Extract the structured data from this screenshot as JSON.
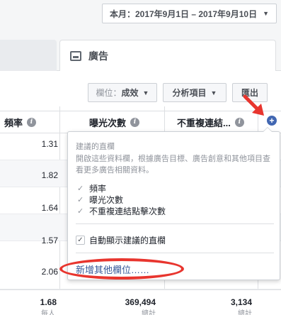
{
  "header": {
    "date_range": "本月：2017年9月1日 – 2017年9月10日"
  },
  "tabs": {
    "ads_label": "廣告"
  },
  "toolbar": {
    "columns_prefix": "欄位：",
    "columns_value": "成效",
    "breakdown_label": "分析項目",
    "export_label": "匯出"
  },
  "table": {
    "headers": {
      "frequency": "頻率",
      "impressions": "曝光次數",
      "unique_link_clicks": "不重複連結..."
    },
    "frequency_values": [
      "1.31",
      "1.82",
      "1.64",
      "1.57",
      "2.06"
    ],
    "totals": {
      "frequency": "1.68",
      "frequency_sub": "每人",
      "impressions": "369,494",
      "impressions_sub": "總計",
      "unique_link_clicks": "3,134",
      "unique_link_clicks_sub": "總計"
    }
  },
  "popover": {
    "title": "建議的直欄",
    "description": "開啟這些資料欄，根據廣告目標、廣告創意和其他項目查看更多廣告相關資料。",
    "items": [
      "頻率",
      "曝光次數",
      "不重複連結點擊次數"
    ],
    "auto_show_label": "自動顯示建議的直欄",
    "add_more_link": "新增其他欄位……"
  },
  "colors": {
    "accent": "#4267b2",
    "link": "#365899",
    "annotation": "#e8352e"
  },
  "icons": [
    "caret-down-icon",
    "ads-tab-icon",
    "info-icon",
    "plus-circle-icon",
    "check-icon",
    "red-arrow-annotation"
  ]
}
